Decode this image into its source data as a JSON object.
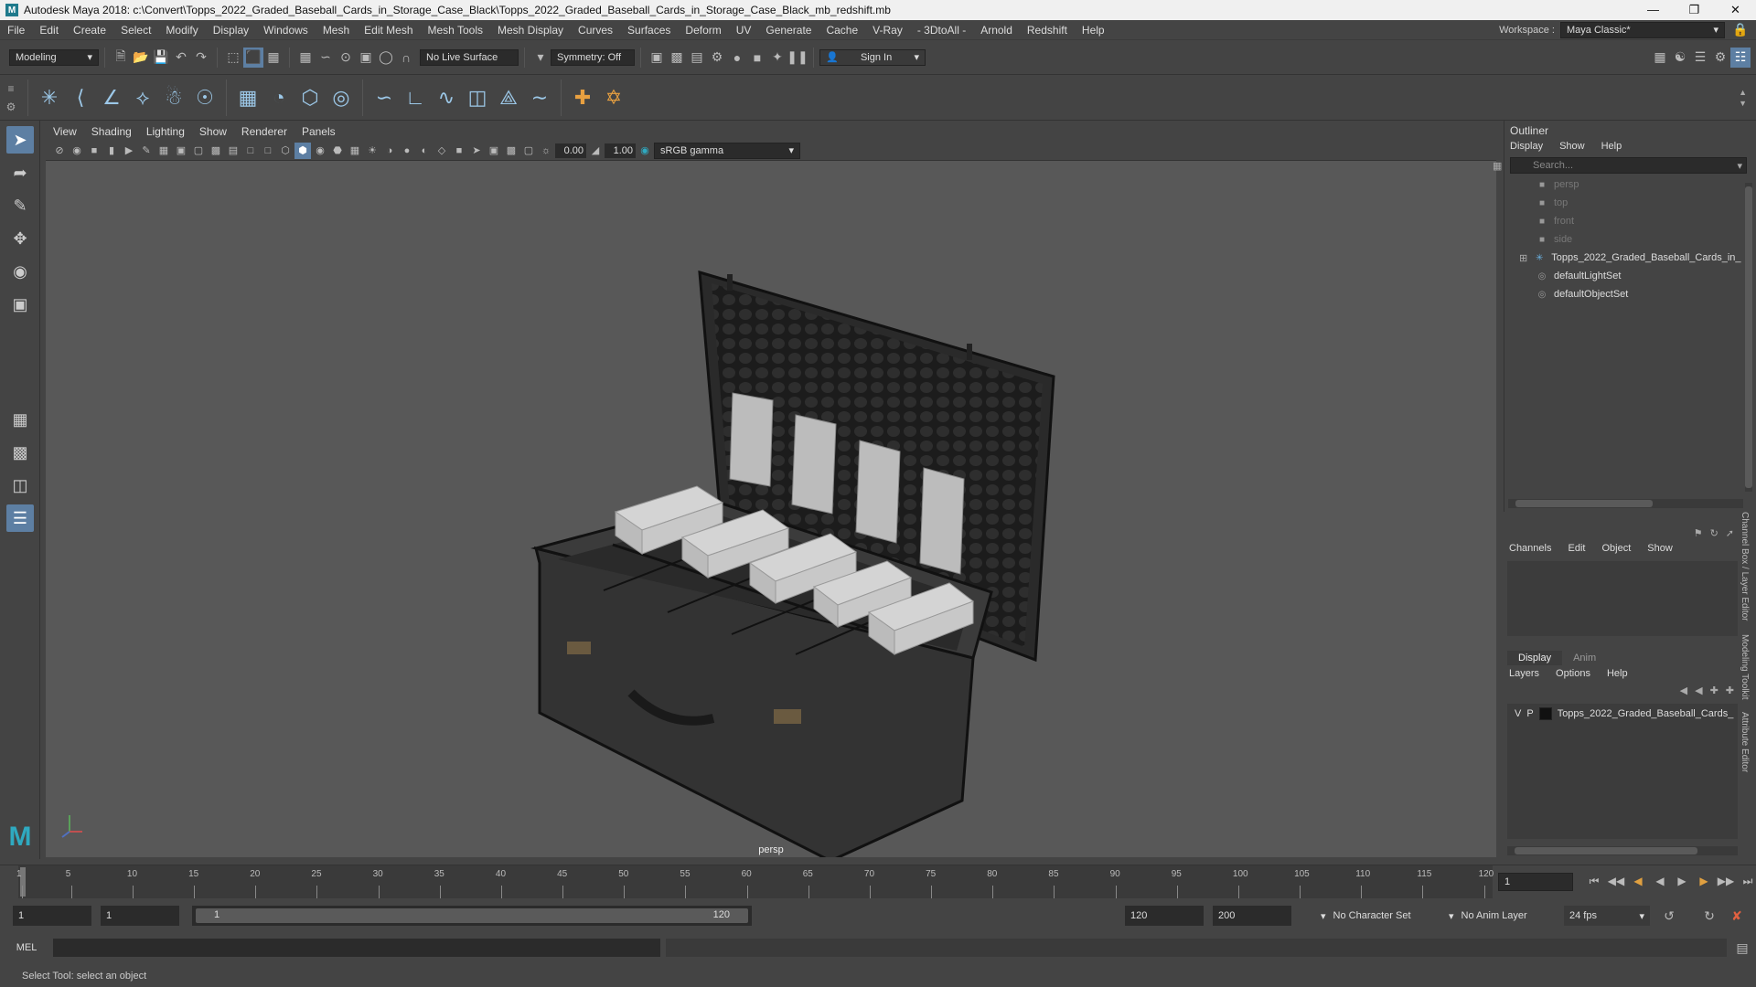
{
  "titlebar": {
    "title": "Autodesk Maya 2018: c:\\Convert\\Topps_2022_Graded_Baseball_Cards_in_Storage_Case_Black\\Topps_2022_Graded_Baseball_Cards_in_Storage_Case_Black_mb_redshift.mb"
  },
  "menubar": {
    "items": [
      "File",
      "Edit",
      "Create",
      "Select",
      "Modify",
      "Display",
      "Windows",
      "Mesh",
      "Edit Mesh",
      "Mesh Tools",
      "Mesh Display",
      "Curves",
      "Surfaces",
      "Deform",
      "UV",
      "Generate",
      "Cache",
      "V-Ray",
      "- 3DtoAll -",
      "Arnold",
      "Redshift",
      "Help"
    ],
    "workspace_label": "Workspace :",
    "workspace_value": "Maya Classic*"
  },
  "statusline": {
    "mode": "Modeling",
    "live_surface": "No Live Surface",
    "symmetry": "Symmetry: Off",
    "sign_in": "Sign In"
  },
  "viewport": {
    "menu": [
      "View",
      "Shading",
      "Lighting",
      "Show",
      "Renderer",
      "Panels"
    ],
    "exposure": "0.00",
    "gamma": "1.00",
    "color_space": "sRGB gamma",
    "camera_label": "persp"
  },
  "outliner": {
    "title": "Outliner",
    "menu": [
      "Display",
      "Show",
      "Help"
    ],
    "search_placeholder": "Search...",
    "items": [
      {
        "label": "persp",
        "kind": "camera"
      },
      {
        "label": "top",
        "kind": "camera"
      },
      {
        "label": "front",
        "kind": "camera"
      },
      {
        "label": "side",
        "kind": "camera"
      },
      {
        "label": "Topps_2022_Graded_Baseball_Cards_in_",
        "kind": "group"
      },
      {
        "label": "defaultLightSet",
        "kind": "set"
      },
      {
        "label": "defaultObjectSet",
        "kind": "set"
      }
    ]
  },
  "channelbox": {
    "menu": [
      "Channels",
      "Edit",
      "Object",
      "Show"
    ]
  },
  "layers": {
    "tabs": [
      "Display",
      "Anim"
    ],
    "menu": [
      "Layers",
      "Options",
      "Help"
    ],
    "layer_v": "V",
    "layer_p": "P",
    "layer_name": "Topps_2022_Graded_Baseball_Cards_"
  },
  "side_tabs": [
    "Channel Box / Layer Editor",
    "Modeling Toolkit",
    "Attribute Editor"
  ],
  "timeline": {
    "ticks": [
      1,
      5,
      10,
      15,
      20,
      25,
      30,
      35,
      40,
      45,
      50,
      55,
      60,
      65,
      70,
      75,
      80,
      85,
      90,
      95,
      100,
      105,
      110,
      115,
      120
    ],
    "current_frame": "1"
  },
  "range": {
    "start": "1",
    "playback_start": "1",
    "slider_start": "1",
    "slider_end": "120",
    "playback_end": "120",
    "end": "200",
    "character_set": "No Character Set",
    "anim_layer": "No Anim Layer",
    "fps": "24 fps"
  },
  "cmdline": {
    "lang": "MEL"
  },
  "helpline": {
    "text": "Select Tool: select an object"
  },
  "colors": {
    "accent": "#5d7fa3",
    "viewport_bg": "#585858"
  }
}
